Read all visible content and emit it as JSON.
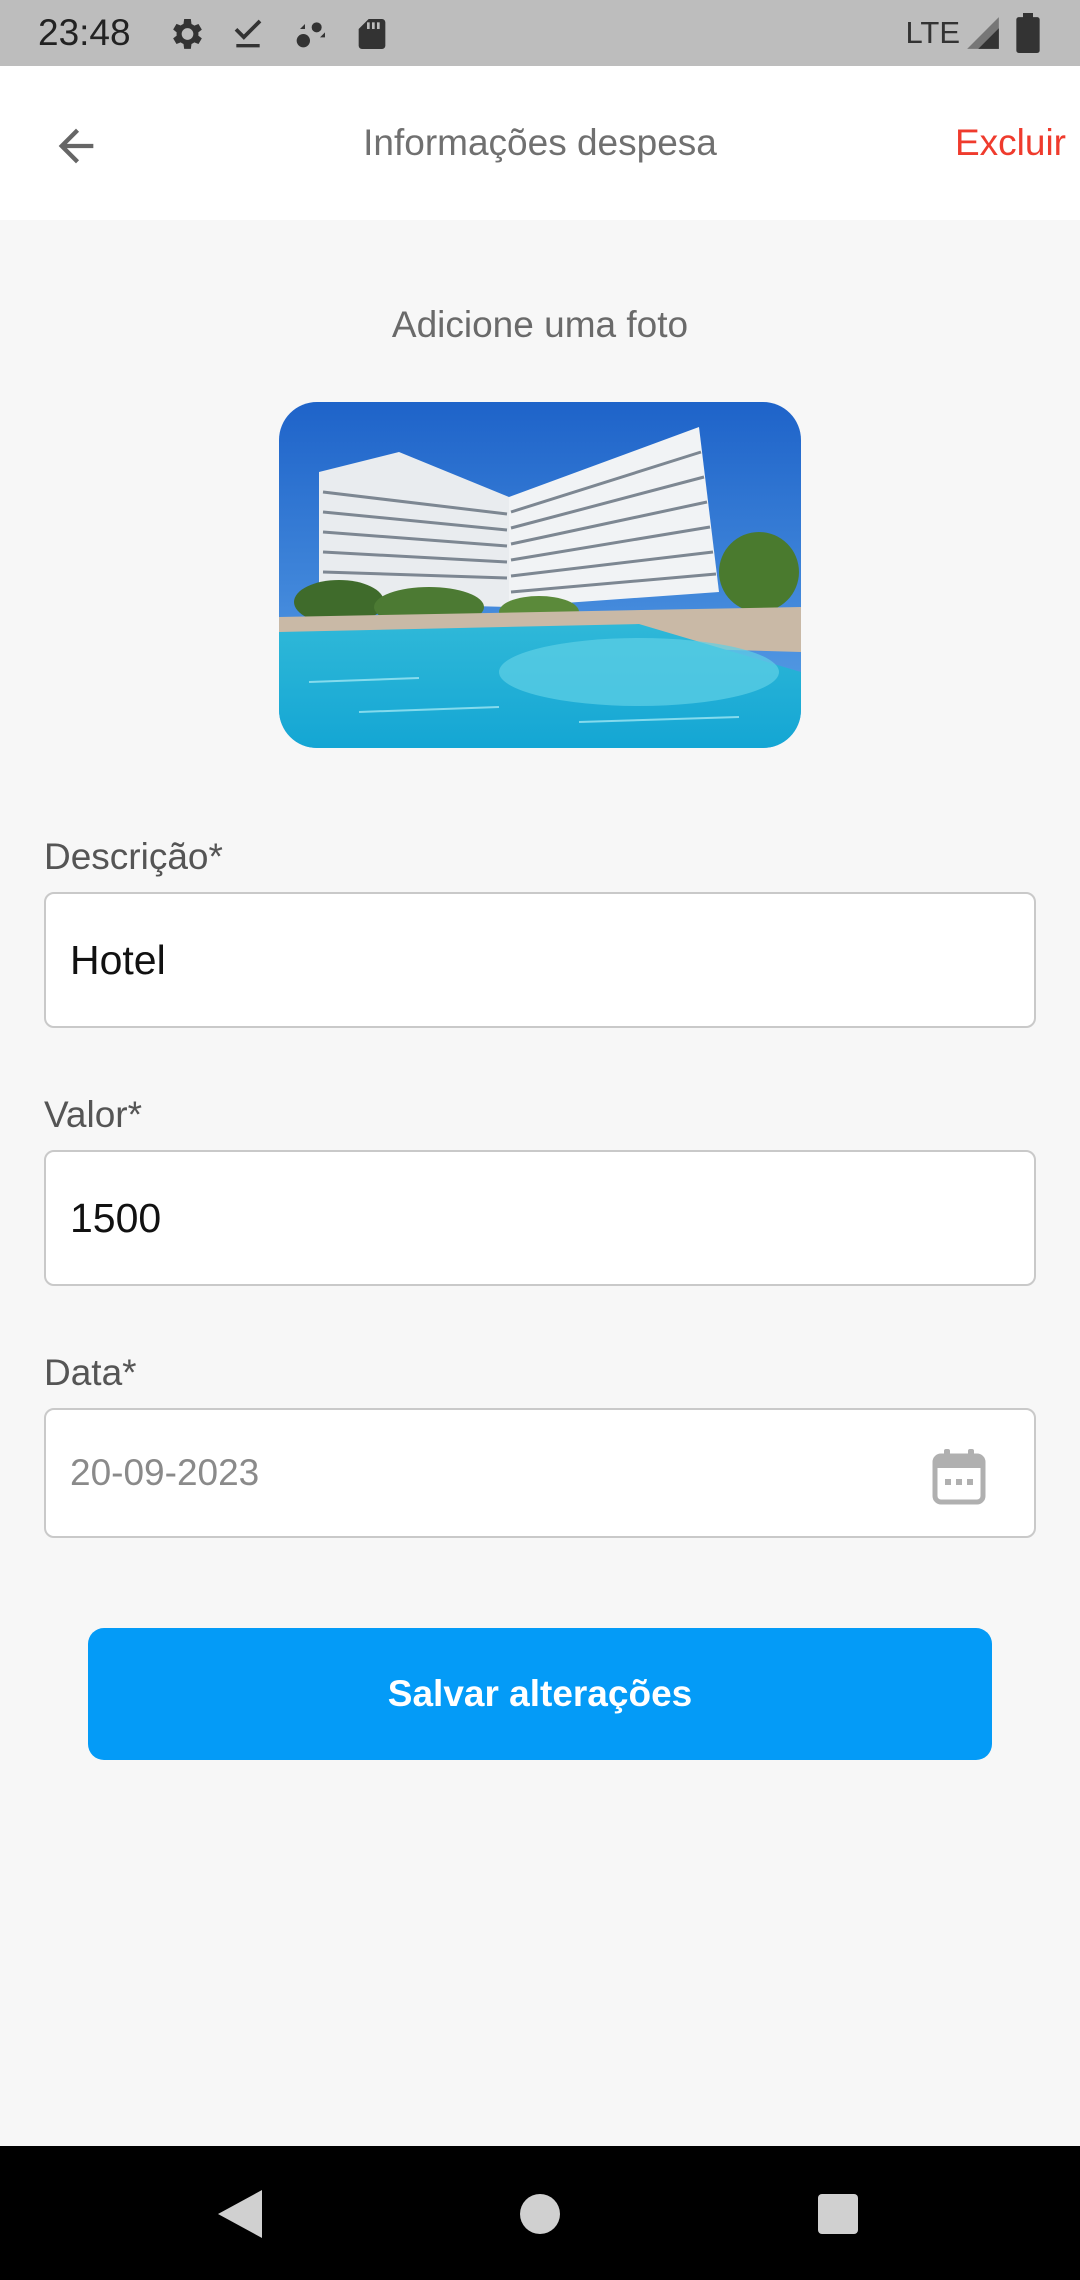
{
  "status_bar": {
    "time": "23:48",
    "network": "LTE",
    "left_icons": [
      "settings-icon",
      "download-done-icon",
      "sync-icon",
      "sd-card-icon"
    ],
    "right_icons": [
      "signal-icon",
      "battery-icon"
    ]
  },
  "app_bar": {
    "back_icon": "arrow-back-icon",
    "title": "Informações despesa",
    "delete_label": "Excluir"
  },
  "photo": {
    "caption": "Adicione uma foto"
  },
  "form": {
    "description": {
      "label": "Descrição*",
      "value": "Hotel"
    },
    "amount": {
      "label": "Valor*",
      "value": "1500"
    },
    "date": {
      "label": "Data*",
      "value": "20-09-2023",
      "icon": "calendar-icon"
    }
  },
  "save_button": {
    "label": "Salvar alterações"
  },
  "colors": {
    "accent": "#049bf7",
    "danger": "#ef3b2d",
    "background": "#f7f7f7"
  },
  "nav_bar": {
    "icons": [
      "nav-back-icon",
      "nav-home-icon",
      "nav-recents-icon"
    ]
  }
}
